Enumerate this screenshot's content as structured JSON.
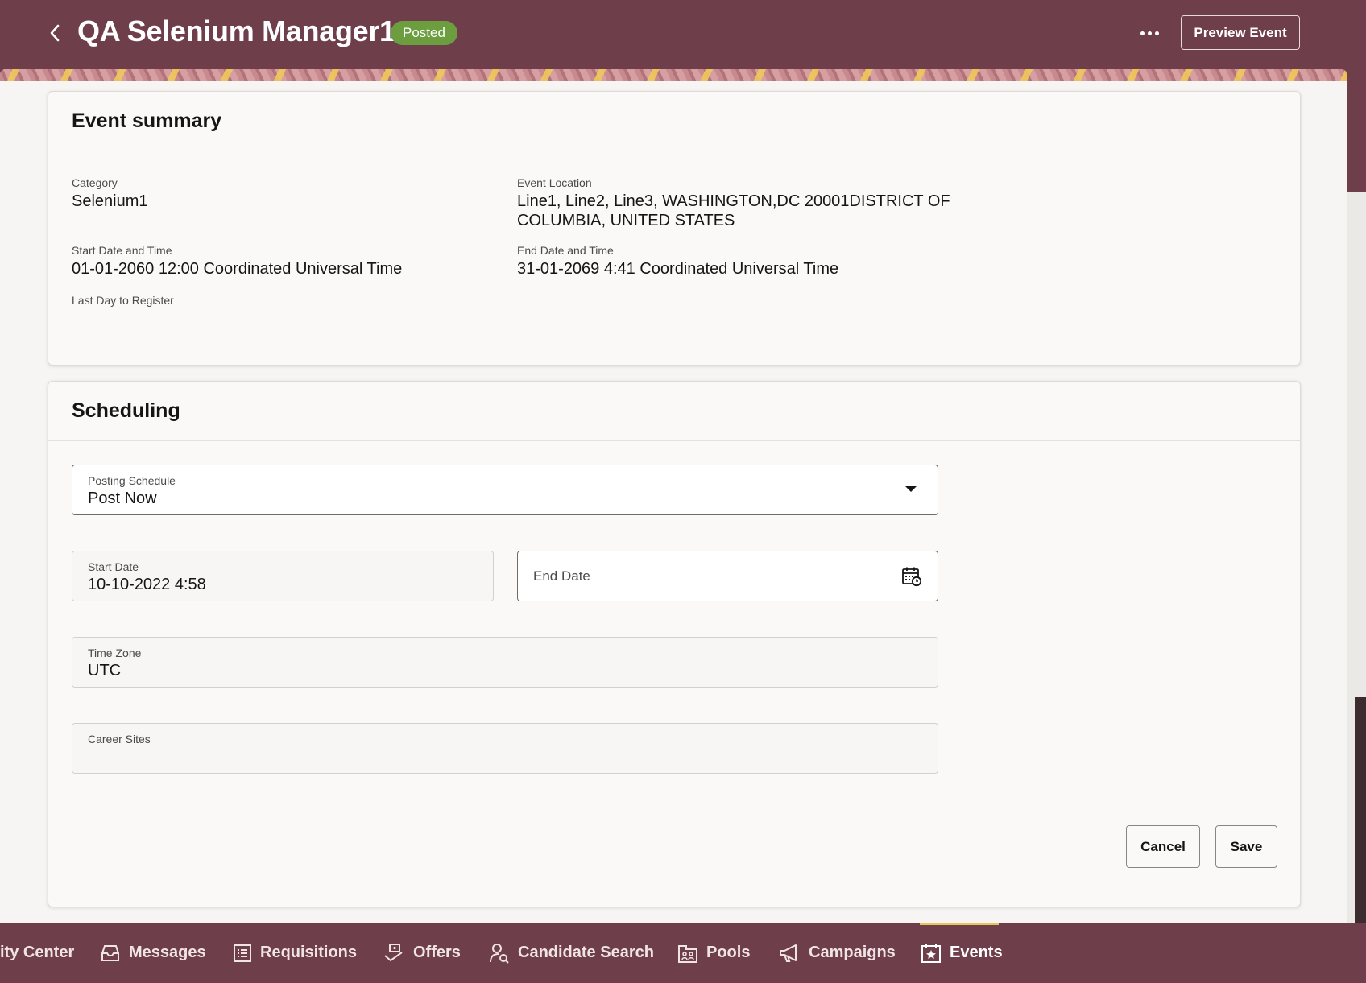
{
  "header": {
    "title": "QA Selenium Manager1",
    "status": "Posted",
    "more_label": "More actions",
    "preview_button": "Preview Event"
  },
  "summary": {
    "title": "Event summary",
    "category_label": "Category",
    "category_value": "Selenium1",
    "location_label": "Event Location",
    "location_line1": "Line1, Line2, Line3, WASHINGTON,DC 20001DISTRICT OF",
    "location_line2": "COLUMBIA, UNITED STATES",
    "start_label": "Start Date and Time",
    "start_value": "01-01-2060 12:00 Coordinated Universal Time",
    "end_label": "End Date and Time",
    "end_value": "31-01-2069 4:41 Coordinated Universal Time",
    "last_day_label": "Last Day to Register"
  },
  "scheduling": {
    "title": "Scheduling",
    "posting_schedule_label": "Posting Schedule",
    "posting_schedule_value": "Post Now",
    "start_date_label": "Start Date",
    "start_date_value": "10-10-2022 4:58",
    "end_date_label": "End Date",
    "time_zone_label": "Time Zone",
    "time_zone_value": "UTC",
    "career_sites_label": "Career Sites",
    "cancel_button": "Cancel",
    "save_button": "Save"
  },
  "nav": {
    "items": [
      {
        "label": "ity Center",
        "icon": "activity-center-icon"
      },
      {
        "label": "Messages",
        "icon": "inbox-icon"
      },
      {
        "label": "Requisitions",
        "icon": "list-icon"
      },
      {
        "label": "Offers",
        "icon": "offers-icon"
      },
      {
        "label": "Candidate Search",
        "icon": "person-search-icon"
      },
      {
        "label": "Pools",
        "icon": "pools-icon"
      },
      {
        "label": "Campaigns",
        "icon": "megaphone-icon"
      },
      {
        "label": "Events",
        "icon": "calendar-star-icon"
      }
    ],
    "active": "Events"
  },
  "colors": {
    "brand": "#6f3e4b",
    "status_badge": "#6c9e3f",
    "active_tab_indicator": "#e8c45c"
  }
}
